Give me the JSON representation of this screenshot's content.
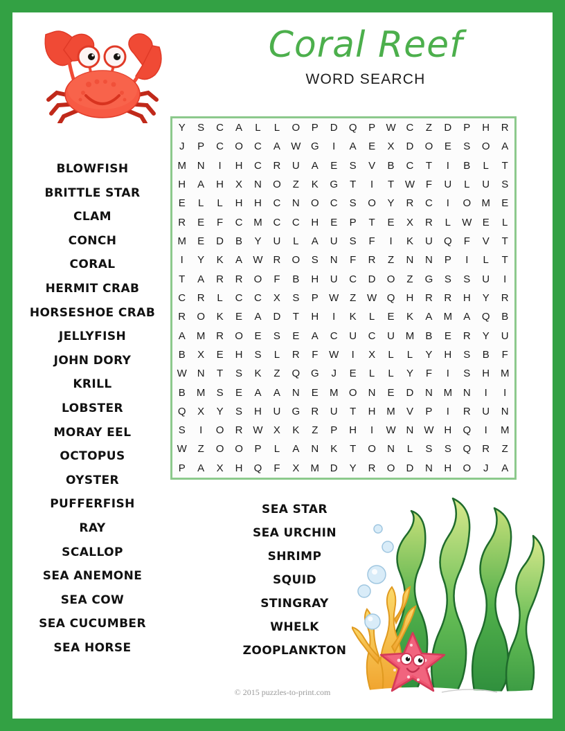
{
  "header": {
    "title": "Coral Reef",
    "subtitle": "WORD SEARCH"
  },
  "colors": {
    "page_border": "#33a144",
    "title_green": "#4caf4c",
    "grid_border": "#8cc98c",
    "crab_red": "#f04a35",
    "starfish_pink": "#ee5566",
    "seaweed_green": "#4caf50",
    "coral_yellow": "#f2c230",
    "bubble_blue": "#bcd9ee"
  },
  "icons": {
    "crab": "crab-icon",
    "seaweed": "seaweed-icon",
    "starfish": "starfish-icon",
    "bubbles": "bubbles-icon"
  },
  "word_list_left": [
    "BLOWFISH",
    "BRITTLE STAR",
    "CLAM",
    "CONCH",
    "CORAL",
    "HERMIT CRAB",
    "HORSESHOE CRAB",
    "JELLYFISH",
    "JOHN DORY",
    "KRILL",
    "LOBSTER",
    "MORAY EEL",
    "OCTOPUS",
    "OYSTER",
    "PUFFERFISH",
    "RAY",
    "SCALLOP",
    "SEA ANEMONE",
    "SEA COW",
    "SEA CUCUMBER",
    "SEA HORSE"
  ],
  "word_list_center": [
    "SEA STAR",
    "SEA URCHIN",
    "SHRIMP",
    "SQUID",
    "STINGRAY",
    "WHELK",
    "ZOOPLANKTON"
  ],
  "grid": {
    "rows": 18,
    "cols": 18,
    "letters": [
      [
        "Y",
        "S",
        "C",
        "A",
        "L",
        "L",
        "O",
        "P",
        "D",
        "Q",
        "P",
        "W",
        "C",
        "Z",
        "D",
        "P",
        "H",
        "R"
      ],
      [
        "J",
        "P",
        "C",
        "O",
        "C",
        "A",
        "W",
        "G",
        "I",
        "A",
        "E",
        "X",
        "D",
        "O",
        "E",
        "S",
        "O",
        "A"
      ],
      [
        "M",
        "N",
        "I",
        "H",
        "C",
        "R",
        "U",
        "A",
        "E",
        "S",
        "V",
        "B",
        "C",
        "T",
        "I",
        "B",
        "L",
        "T"
      ],
      [
        "H",
        "A",
        "H",
        "X",
        "N",
        "O",
        "Z",
        "K",
        "G",
        "T",
        "I",
        "T",
        "W",
        "F",
        "U",
        "L",
        "U",
        "S"
      ],
      [
        "E",
        "L",
        "L",
        "H",
        "H",
        "C",
        "N",
        "O",
        "C",
        "S",
        "O",
        "Y",
        "R",
        "C",
        "I",
        "O",
        "M",
        "E"
      ],
      [
        "R",
        "E",
        "F",
        "C",
        "M",
        "C",
        "C",
        "H",
        "E",
        "P",
        "T",
        "E",
        "X",
        "R",
        "L",
        "W",
        "E",
        "L"
      ],
      [
        "M",
        "E",
        "D",
        "B",
        "Y",
        "U",
        "L",
        "A",
        "U",
        "S",
        "F",
        "I",
        "K",
        "U",
        "Q",
        "F",
        "V",
        "T"
      ],
      [
        "I",
        "Y",
        "K",
        "A",
        "W",
        "R",
        "O",
        "S",
        "N",
        "F",
        "R",
        "Z",
        "N",
        "N",
        "P",
        "I",
        "L",
        "T"
      ],
      [
        "T",
        "A",
        "R",
        "R",
        "O",
        "F",
        "B",
        "H",
        "U",
        "C",
        "D",
        "O",
        "Z",
        "G",
        "S",
        "S",
        "U",
        "I"
      ],
      [
        "C",
        "R",
        "L",
        "C",
        "C",
        "X",
        "S",
        "P",
        "W",
        "Z",
        "W",
        "Q",
        "H",
        "R",
        "R",
        "H",
        "Y",
        "R"
      ],
      [
        "R",
        "O",
        "K",
        "E",
        "A",
        "D",
        "T",
        "H",
        "I",
        "K",
        "L",
        "E",
        "K",
        "A",
        "M",
        "A",
        "Q",
        "B"
      ],
      [
        "A",
        "M",
        "R",
        "O",
        "E",
        "S",
        "E",
        "A",
        "C",
        "U",
        "C",
        "U",
        "M",
        "B",
        "E",
        "R",
        "Y",
        "U"
      ],
      [
        "B",
        "X",
        "E",
        "H",
        "S",
        "L",
        "R",
        "F",
        "W",
        "I",
        "X",
        "L",
        "L",
        "Y",
        "H",
        "S",
        "B",
        "F"
      ],
      [
        "W",
        "N",
        "T",
        "S",
        "K",
        "Z",
        "Q",
        "G",
        "J",
        "E",
        "L",
        "L",
        "Y",
        "F",
        "I",
        "S",
        "H",
        "M"
      ],
      [
        "B",
        "M",
        "S",
        "E",
        "A",
        "A",
        "N",
        "E",
        "M",
        "O",
        "N",
        "E",
        "D",
        "N",
        "M",
        "N",
        "I",
        "I"
      ],
      [
        "Q",
        "X",
        "Y",
        "S",
        "H",
        "U",
        "G",
        "R",
        "U",
        "T",
        "H",
        "M",
        "V",
        "P",
        "I",
        "R",
        "U",
        "N"
      ],
      [
        "S",
        "I",
        "O",
        "R",
        "W",
        "X",
        "K",
        "Z",
        "P",
        "H",
        "I",
        "W",
        "N",
        "W",
        "H",
        "Q",
        "I",
        "M"
      ],
      [
        "W",
        "Z",
        "O",
        "O",
        "P",
        "L",
        "A",
        "N",
        "K",
        "T",
        "O",
        "N",
        "L",
        "S",
        "S",
        "Q",
        "R",
        "Z"
      ],
      [
        "P",
        "A",
        "X",
        "H",
        "Q",
        "F",
        "X",
        "M",
        "D",
        "Y",
        "R",
        "O",
        "D",
        "N",
        "H",
        "O",
        "J",
        "A"
      ]
    ]
  },
  "footer": {
    "copyright": "© 2015 puzzles-to-print.com"
  }
}
